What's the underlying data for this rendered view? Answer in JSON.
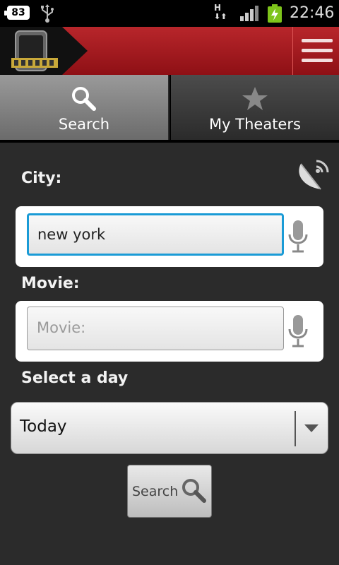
{
  "status_bar": {
    "battery_level": "83",
    "network_type": "H",
    "time": "22:46"
  },
  "tabs": [
    {
      "label": "Search",
      "icon": "search-icon",
      "active": true
    },
    {
      "label": "My Theaters",
      "icon": "star-icon",
      "active": false
    }
  ],
  "form": {
    "city_label": "City:",
    "city_value": "new york",
    "movie_label": "Movie:",
    "movie_placeholder": "Movie:",
    "day_label": "Select a day",
    "day_value": "Today",
    "search_button_label": "Search"
  },
  "colors": {
    "header_red": "#b8262b",
    "focus_blue": "#1a9bd6"
  }
}
